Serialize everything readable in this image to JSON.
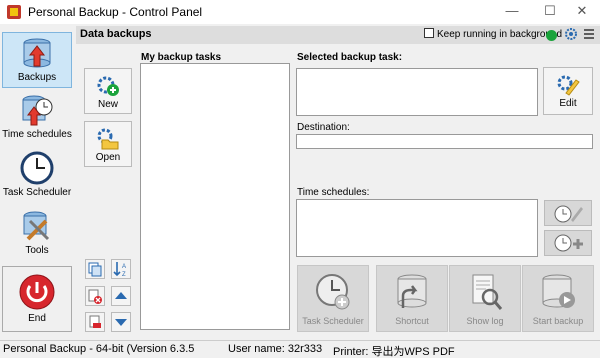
{
  "window": {
    "title": "Personal Backup - Control Panel",
    "minimize": "—",
    "maximize": "☐",
    "close": "✕"
  },
  "nav": {
    "items": [
      {
        "label": "Backups"
      },
      {
        "label": "Time schedules"
      },
      {
        "label": "Task Scheduler"
      },
      {
        "label": "Tools"
      }
    ],
    "end_label": "End"
  },
  "header": {
    "title": "Data backups",
    "keep_running": "Keep running in background"
  },
  "tasks": {
    "label": "My backup tasks",
    "new_label": "New",
    "open_label": "Open"
  },
  "selected": {
    "label": "Selected backup task:",
    "edit_label": "Edit"
  },
  "destination": {
    "label": "Destination:"
  },
  "schedules": {
    "label": "Time schedules:"
  },
  "actions": [
    {
      "label": "Task Scheduler"
    },
    {
      "label": "Shortcut"
    },
    {
      "label": "Show log"
    },
    {
      "label": "Start backup"
    }
  ],
  "status": {
    "version": "Personal Backup - 64-bit (Version 6.3.5",
    "user": "User name: 32r333",
    "printer": "Printer: 导出为WPS PDF"
  },
  "colors": {
    "accent_green": "#1aa33b",
    "nav_active": "#cde6f7",
    "end_red": "#d7262d"
  }
}
